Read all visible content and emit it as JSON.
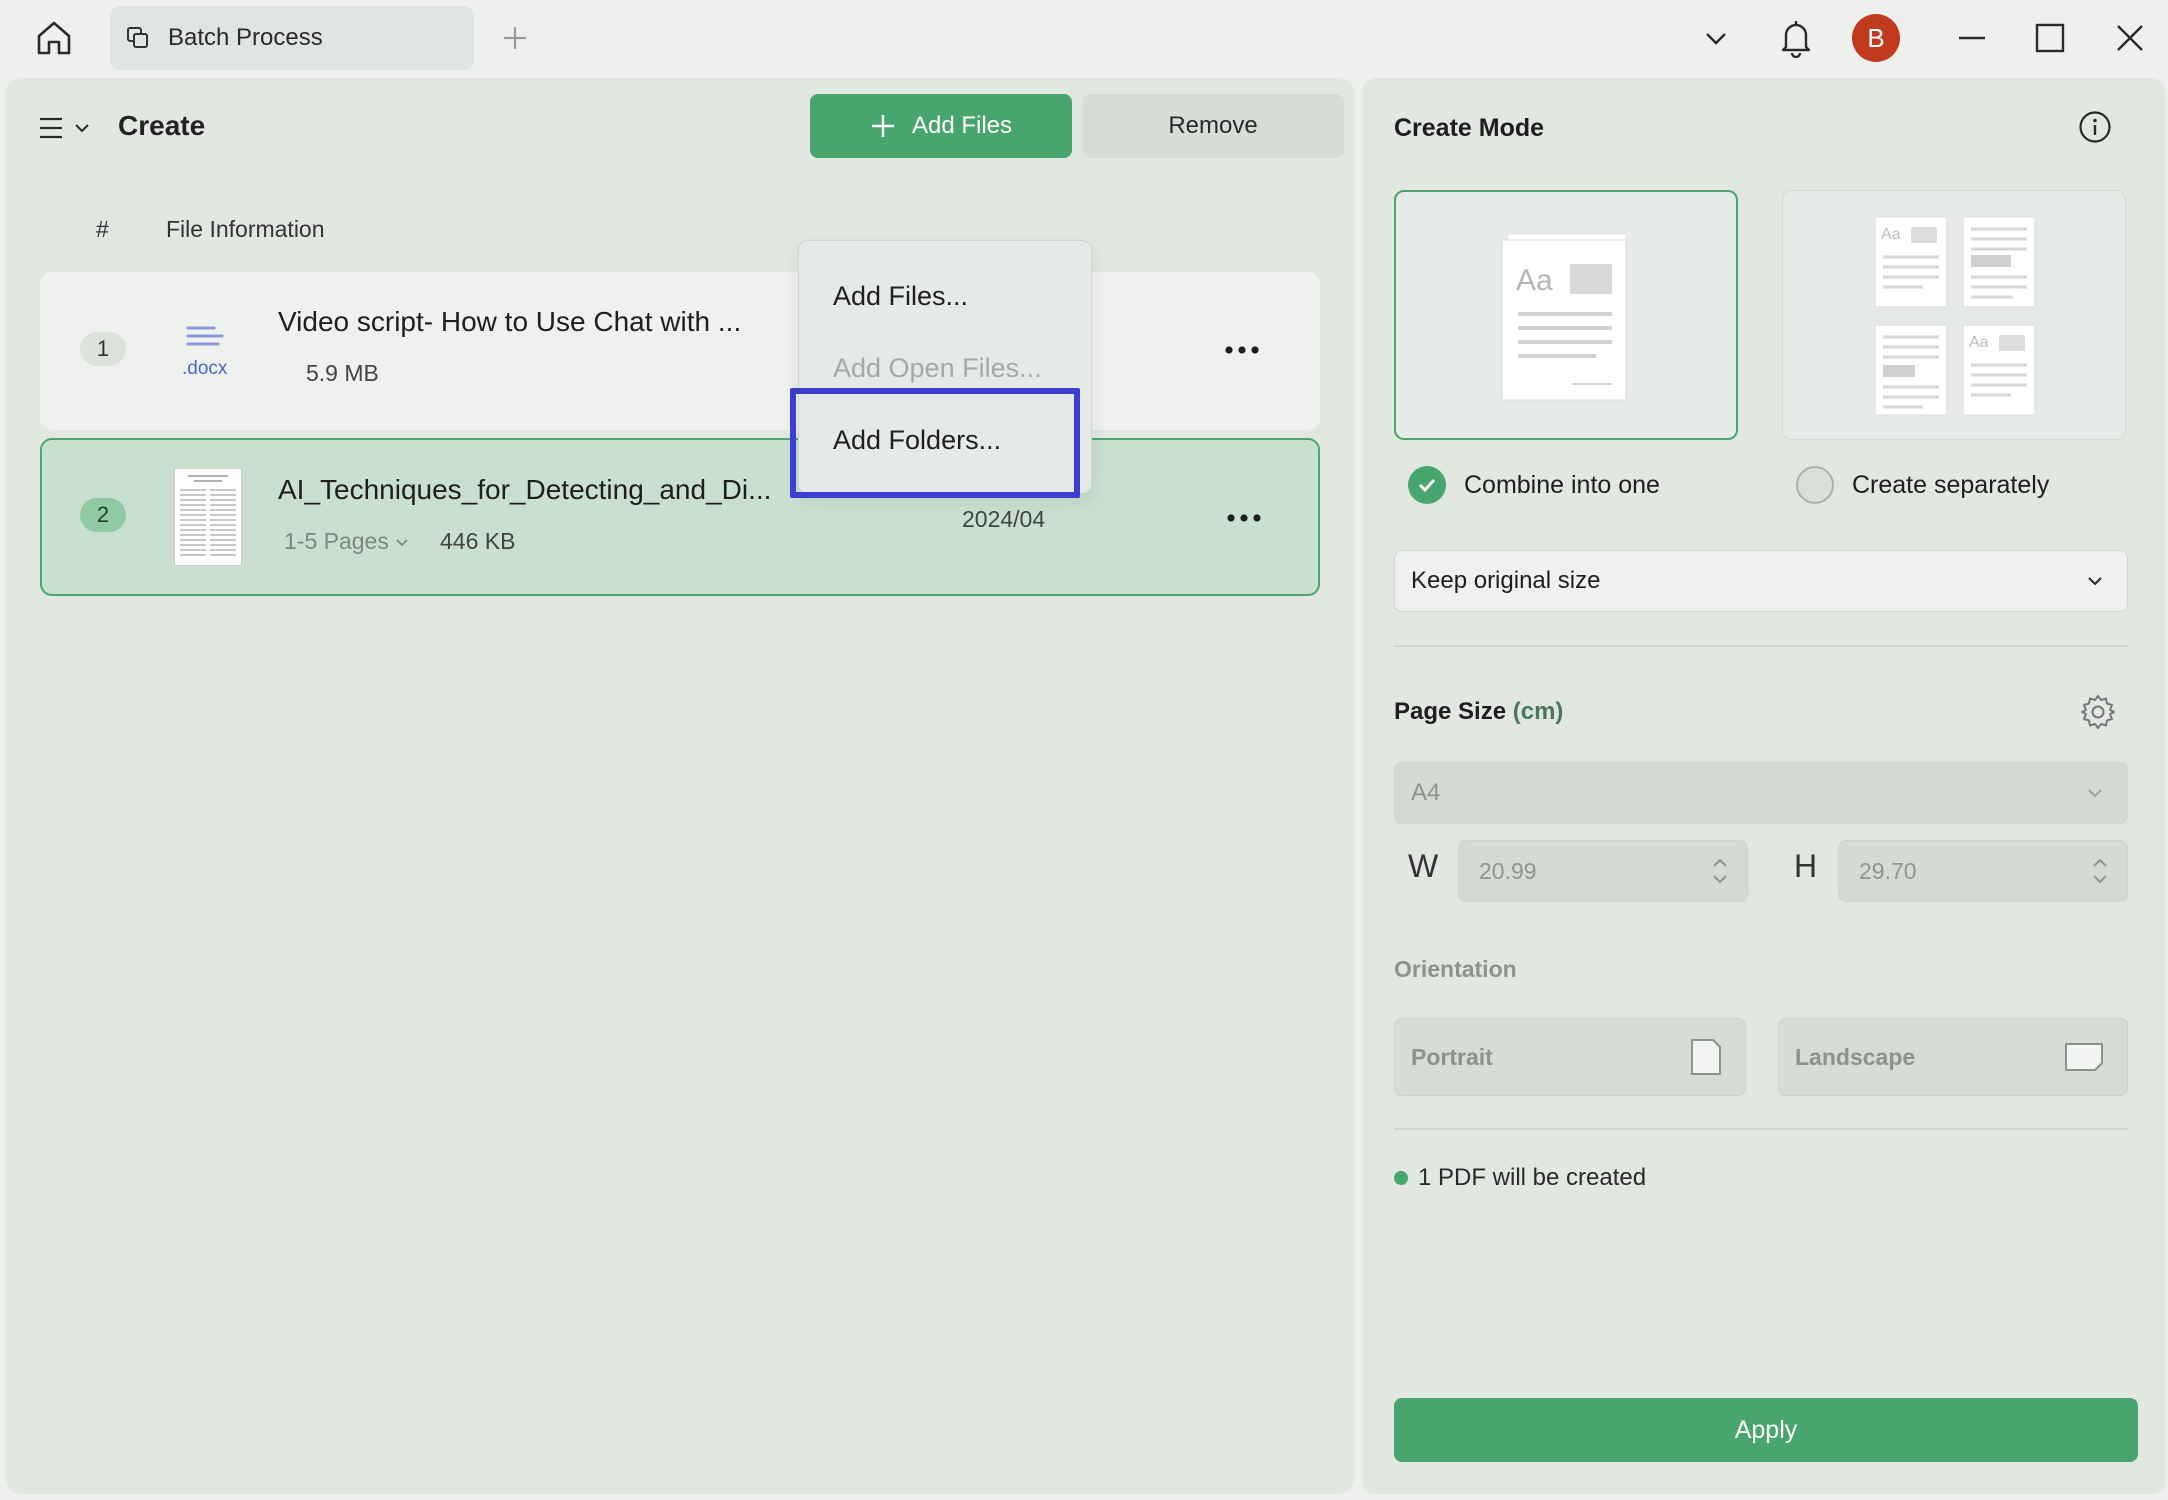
{
  "titlebar": {
    "tab_label": "Batch Process",
    "avatar_initial": "B"
  },
  "toolbar": {
    "title": "Create",
    "add_files_label": "Add Files",
    "remove_label": "Remove"
  },
  "table": {
    "col_number": "#",
    "col_info": "File Information"
  },
  "files": [
    {
      "number": "1",
      "name": "Video script- How to Use Chat with ...",
      "ext": ".docx",
      "size": "5.9 MB"
    },
    {
      "number": "2",
      "name": "AI_Techniques_for_Detecting_and_Di...",
      "pages": "1-5 Pages",
      "size": "446 KB",
      "date": "2024/04"
    }
  ],
  "add_menu": {
    "items": [
      "Add Files...",
      "Add Open Files...",
      "Add Folders..."
    ],
    "disabled_index": 1,
    "highlighted_index": 2
  },
  "settings": {
    "title": "Create Mode",
    "mode_combine": "Combine into one",
    "mode_separate": "Create separately",
    "selected_mode": "combine",
    "size_option": "Keep original size",
    "page_size_label": "Page Size",
    "page_size_unit": "(cm)",
    "page_size_value": "A4",
    "width_label": "W",
    "width_value": "20.99",
    "height_label": "H",
    "height_value": "29.70",
    "orientation_label": "Orientation",
    "portrait_label": "Portrait",
    "landscape_label": "Landscape",
    "status_text": "1 PDF will be created",
    "apply_label": "Apply"
  },
  "colors": {
    "accent": "#48a56d",
    "avatar": "#c23a1e",
    "highlight": "#3b3fcf"
  },
  "icons": {
    "home": "home-icon",
    "tab": "copy-icon",
    "new_tab": "plus-icon",
    "dropdown": "chevron-down-icon",
    "notifications": "bell-icon",
    "minimize": "minimize-icon",
    "maximize": "maximize-icon",
    "close": "close-icon",
    "menu": "hamburger-icon",
    "more": "more-horizontal-icon",
    "info": "info-icon",
    "settings": "gear-icon",
    "portrait": "portrait-page-icon",
    "landscape": "landscape-page-icon"
  }
}
